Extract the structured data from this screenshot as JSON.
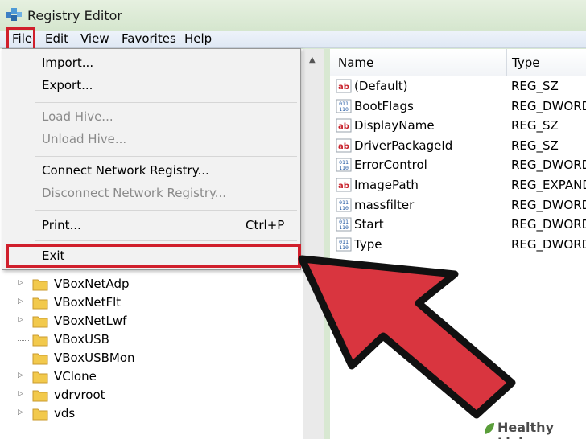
{
  "window": {
    "title": "Registry Editor"
  },
  "menubar": {
    "items": [
      "File",
      "Edit",
      "View",
      "Favorites",
      "Help"
    ]
  },
  "file_menu": {
    "import": "Import...",
    "export": "Export...",
    "load_hive": "Load Hive...",
    "unload_hive": "Unload Hive...",
    "connect": "Connect Network Registry...",
    "disconnect": "Disconnect Network Registry...",
    "print": "Print...",
    "print_shortcut": "Ctrl+P",
    "exit": "Exit"
  },
  "tree": {
    "items": [
      "VBoxNetAdp",
      "VBoxNetFlt",
      "VBoxNetLwf",
      "VBoxUSB",
      "VBoxUSBMon",
      "VClone",
      "vdrvroot",
      "vds"
    ]
  },
  "list": {
    "headers": {
      "name": "Name",
      "type": "Type"
    },
    "rows": [
      {
        "name": "(Default)",
        "type": "REG_SZ",
        "icon": "string-value-icon"
      },
      {
        "name": "BootFlags",
        "type": "REG_DWORD",
        "icon": "binary-value-icon"
      },
      {
        "name": "DisplayName",
        "type": "REG_SZ",
        "icon": "string-value-icon"
      },
      {
        "name": "DriverPackageId",
        "type": "REG_SZ",
        "icon": "string-value-icon"
      },
      {
        "name": "ErrorControl",
        "type": "REG_DWORD",
        "icon": "binary-value-icon"
      },
      {
        "name": "ImagePath",
        "type": "REG_EXPAND",
        "icon": "string-value-icon"
      },
      {
        "name": "massfilter",
        "type": "REG_DWORD",
        "icon": "binary-value-icon"
      },
      {
        "name": "Start",
        "type": "REG_DWORD",
        "icon": "binary-value-icon"
      },
      {
        "name": "Type",
        "type": "REG_DWORD",
        "icon": "binary-value-icon"
      }
    ]
  },
  "colors": {
    "highlight_red": "#d01f2c",
    "folder_yellow": "#f2c94c"
  },
  "watermark": {
    "text": "Healthy Living"
  }
}
